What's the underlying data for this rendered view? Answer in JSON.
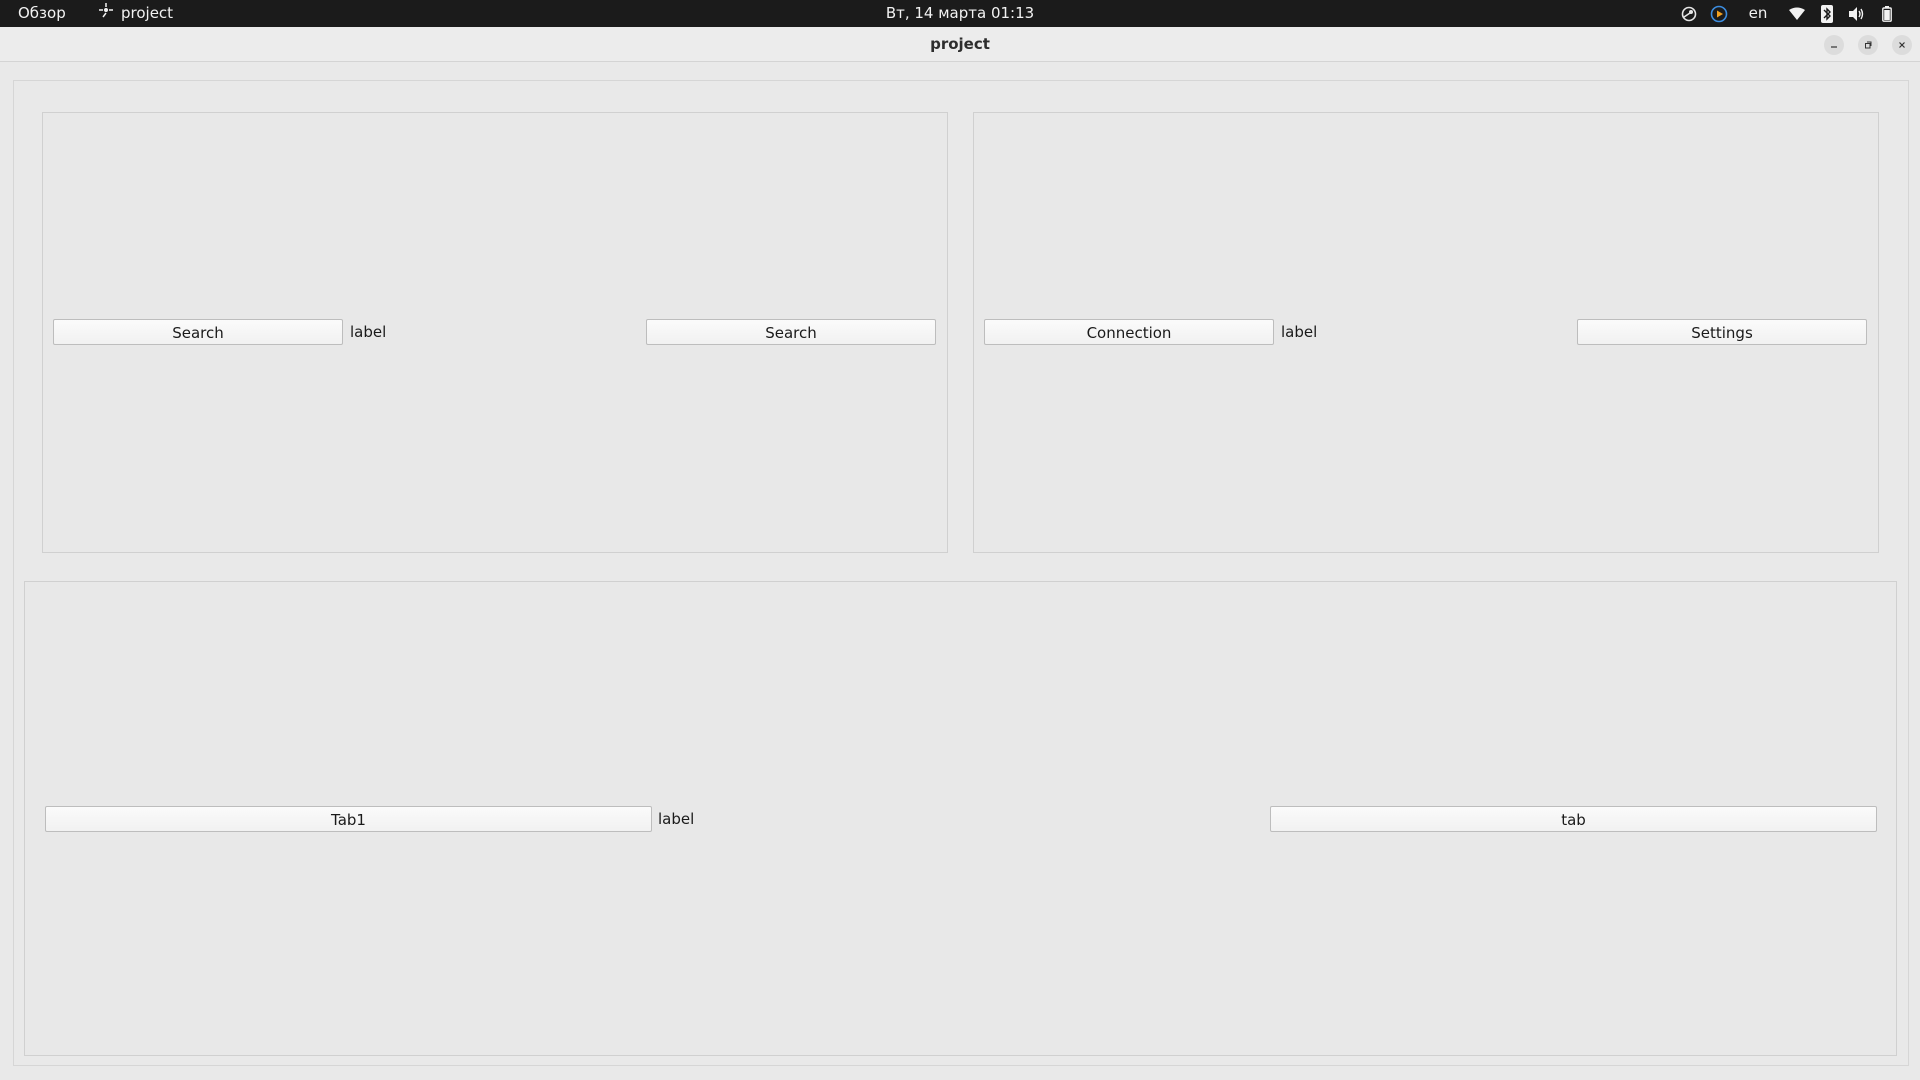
{
  "topbar": {
    "activities": "Обзор",
    "app_name": "project",
    "clock": "Вт, 14 марта  01:13",
    "language": "en",
    "icons": [
      "steam-icon",
      "media-play-icon",
      "wifi-icon",
      "bluetooth-icon",
      "volume-icon",
      "battery-icon"
    ]
  },
  "window": {
    "title": "project"
  },
  "panel_a": {
    "left_button": "Search",
    "label": "label",
    "right_button": "Search"
  },
  "panel_b": {
    "left_button": "Connection",
    "label": "label",
    "right_button": "Settings"
  },
  "panel_c": {
    "left_button": "Tab1",
    "label": "label",
    "right_button": "tab"
  }
}
